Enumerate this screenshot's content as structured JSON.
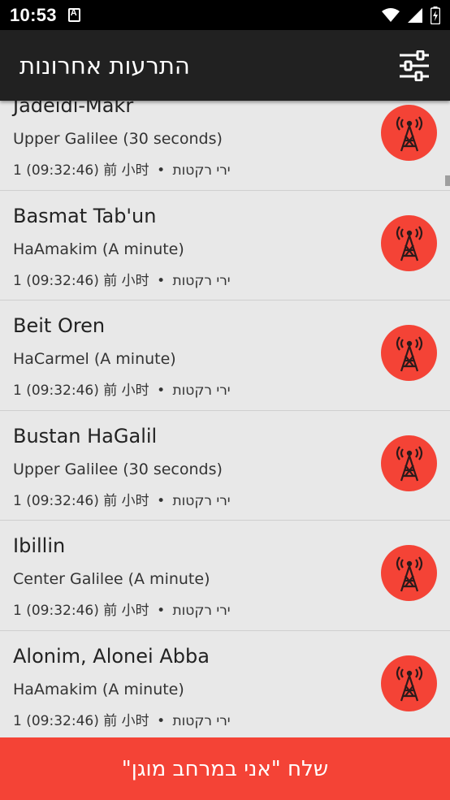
{
  "status_bar": {
    "time": "10:53"
  },
  "app_bar": {
    "title": "התרעות אחרונות",
    "filter_icon": "sliders-icon"
  },
  "alerts": [
    {
      "city": "Jadeidi-Makr",
      "zone": "Upper Galilee (30 seconds)",
      "source": "ירי רקטות",
      "bullet": "•",
      "time": "1 (09:32:46) 前 小时"
    },
    {
      "city": "Basmat Tab'un",
      "zone": "HaAmakim (A minute)",
      "source": "ירי רקטות",
      "bullet": "•",
      "time": "1 (09:32:46) 前 小时"
    },
    {
      "city": "Beit Oren",
      "zone": "HaCarmel (A minute)",
      "source": "ירי רקטות",
      "bullet": "•",
      "time": "1 (09:32:46) 前 小时"
    },
    {
      "city": "Bustan HaGalil",
      "zone": "Upper Galilee (30 seconds)",
      "source": "ירי רקטות",
      "bullet": "•",
      "time": "1 (09:32:46) 前 小时"
    },
    {
      "city": "Ibillin",
      "zone": "Center Galilee (A minute)",
      "source": "ירי רקטות",
      "bullet": "•",
      "time": "1 (09:32:46) 前 小时"
    },
    {
      "city": "Alonim, Alonei Abba",
      "zone": "HaAmakim (A minute)",
      "source": "ירי רקטות",
      "bullet": "•",
      "time": "1 (09:32:46) 前 小时"
    }
  ],
  "bottom_button": {
    "label": "שלח \"אני במרחב מוגן\""
  },
  "colors": {
    "accent": "#f44336",
    "app_bar": "#212121",
    "background": "#e8e8e8"
  }
}
